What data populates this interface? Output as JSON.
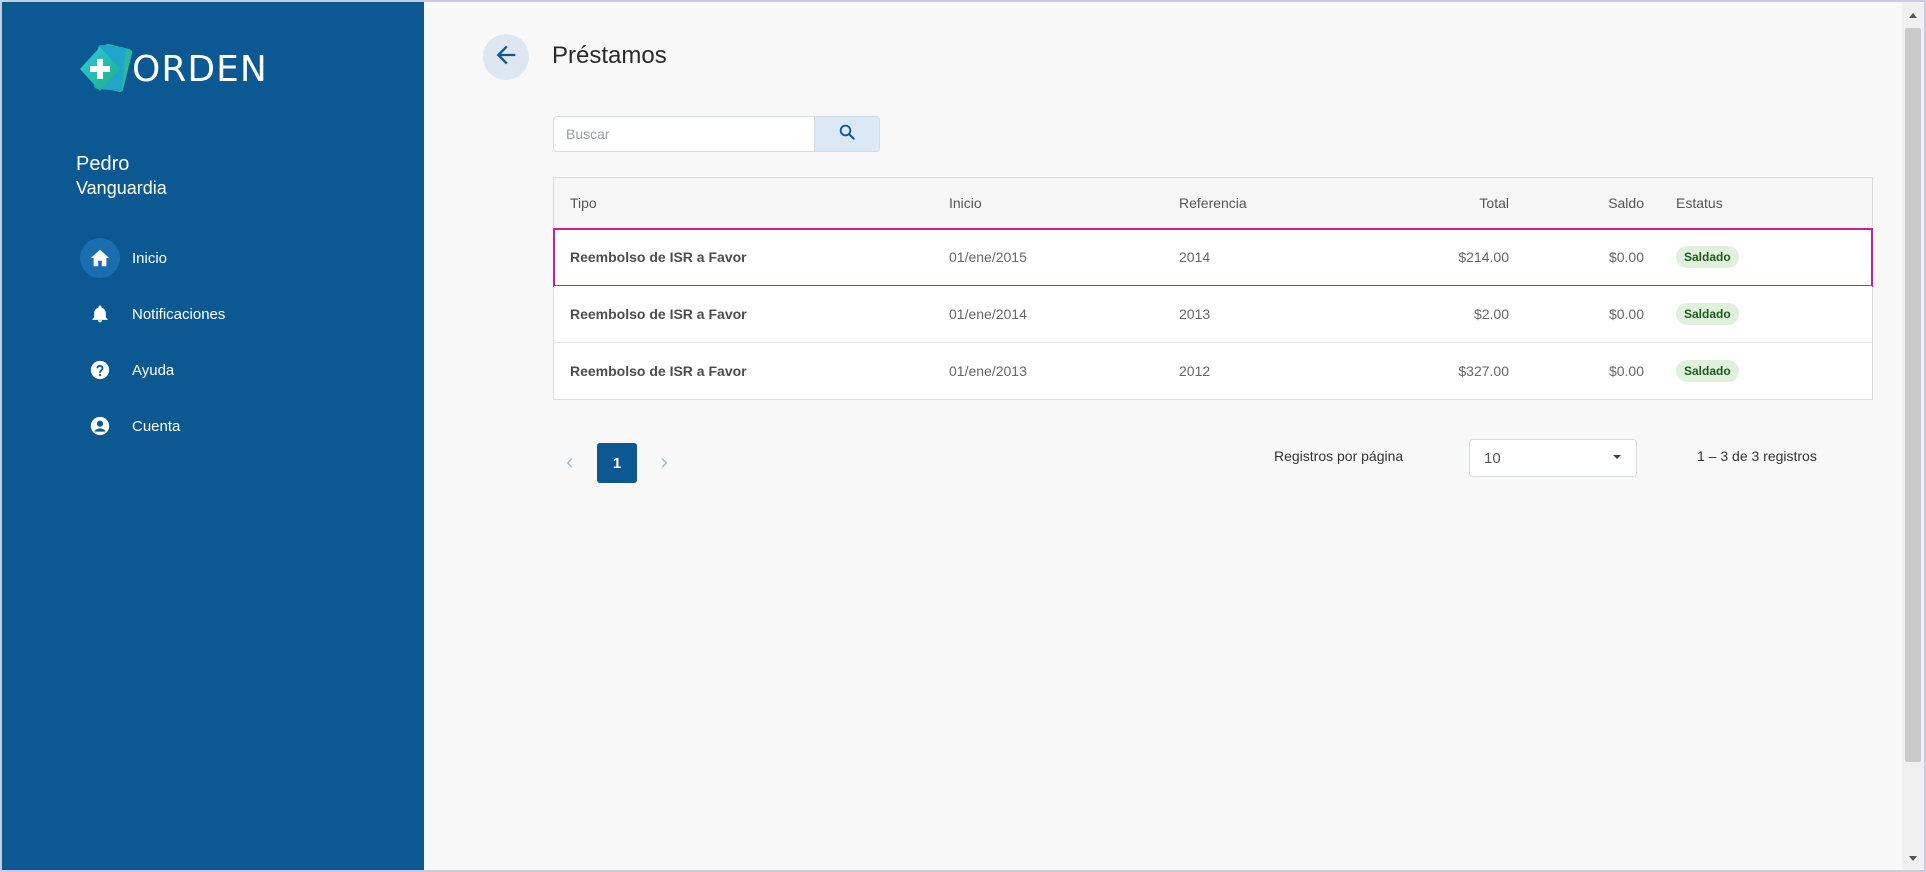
{
  "brand": {
    "name": "ORDEN",
    "colors": {
      "sidebar": "#0b5893",
      "accent": "#1a6eb0",
      "badge": "#dff1dc",
      "highlight": "#c21fa8"
    }
  },
  "user": {
    "first_name": "Pedro",
    "last_name": "Vanguardia"
  },
  "sidebar": {
    "items": [
      {
        "label": "Inicio",
        "icon": "home-icon",
        "active": true
      },
      {
        "label": "Notificaciones",
        "icon": "bell-icon",
        "active": false
      },
      {
        "label": "Ayuda",
        "icon": "help-icon",
        "active": false
      },
      {
        "label": "Cuenta",
        "icon": "account-icon",
        "active": false
      }
    ]
  },
  "header": {
    "title": "Préstamos",
    "back_icon": "arrow-left-icon"
  },
  "search": {
    "placeholder": "Buscar",
    "value": "",
    "icon": "search-icon"
  },
  "table": {
    "columns": [
      "Tipo",
      "Inicio",
      "Referencia",
      "Total",
      "Saldo",
      "Estatus"
    ],
    "rows": [
      {
        "tipo": "Reembolso de ISR a Favor",
        "inicio": "01/ene/2015",
        "referencia": "2014",
        "total": "$214.00",
        "saldo": "$0.00",
        "estatus": "Saldado"
      },
      {
        "tipo": "Reembolso de ISR a Favor",
        "inicio": "01/ene/2014",
        "referencia": "2013",
        "total": "$2.00",
        "saldo": "$0.00",
        "estatus": "Saldado"
      },
      {
        "tipo": "Reembolso de ISR a Favor",
        "inicio": "01/ene/2013",
        "referencia": "2012",
        "total": "$327.00",
        "saldo": "$0.00",
        "estatus": "Saldado"
      }
    ]
  },
  "pagination": {
    "current_page": "1",
    "rows_per_page_label": "Registros por página",
    "rows_per_page": "10",
    "range_text": "1 – 3 de 3 registros"
  }
}
